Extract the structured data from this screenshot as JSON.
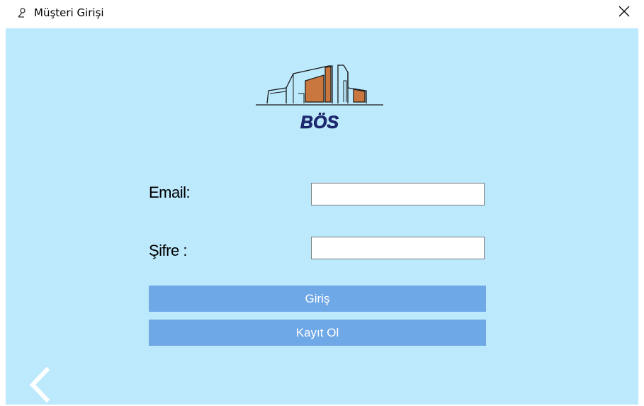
{
  "window": {
    "title": "Müşteri Girişi",
    "icon": "user-pen-icon",
    "close_icon": "close-icon"
  },
  "logo": {
    "text": "BÖS",
    "icon": "building-logo",
    "colors": {
      "brown": "#c9763f",
      "outline": "#1a1a1a",
      "text": "#1e2a78"
    }
  },
  "form": {
    "email_label": "Email:",
    "email_value": "",
    "password_label": "Şifre :",
    "password_value": ""
  },
  "buttons": {
    "login_label": "Giriş",
    "register_label": "Kayıt Ol",
    "back_icon": "chevron-left-icon"
  },
  "colors": {
    "background": "#bde9fd",
    "button": "#6fa8e6",
    "button_text": "#ffffff"
  }
}
